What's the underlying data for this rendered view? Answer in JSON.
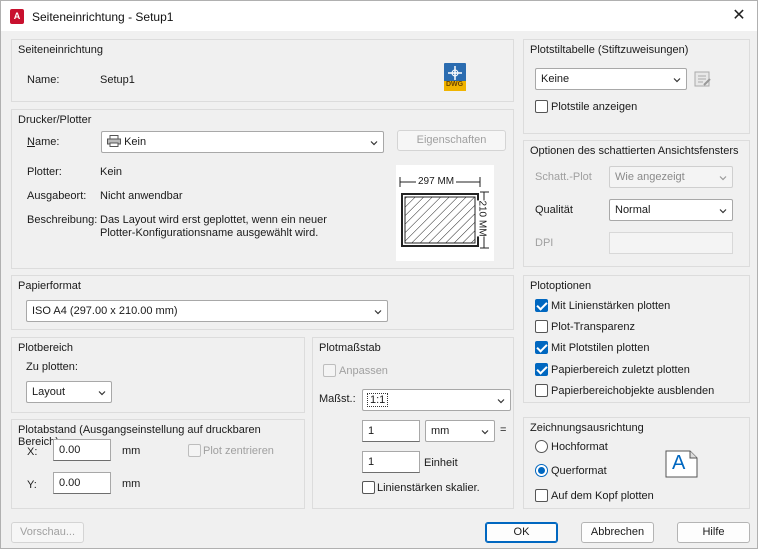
{
  "window": {
    "title": "Seiteneinrichtung - Setup1",
    "app_icon_letter": "A"
  },
  "page_setup": {
    "title": "Seiteneinrichtung",
    "name_label": "Name:",
    "name_value": "Setup1",
    "dwg_icon_text": "DWG"
  },
  "printer": {
    "title": "Drucker/Plotter",
    "name_label": "Name:",
    "name_value": "Kein",
    "properties_button": "Eigenschaften",
    "plotter_label": "Plotter:",
    "plotter_value": "Kein",
    "location_label": "Ausgabeort:",
    "location_value": "Nicht anwendbar",
    "description_label": "Beschreibung:",
    "description_line1": "Das Layout wird erst geplottet, wenn ein neuer",
    "description_line2": "Plotter-Konfigurationsname ausgewählt wird.",
    "preview_width": "297 MM",
    "preview_height": "210 MM"
  },
  "paper": {
    "title": "Papierformat",
    "value": "ISO A4 (297.00 x 210.00 mm)"
  },
  "plot_area": {
    "title": "Plotbereich",
    "what_label": "Zu plotten:",
    "what_value": "Layout"
  },
  "plot_offset": {
    "title": "Plotabstand (Ausgangseinstellung auf druckbaren Bereich)",
    "x_label": "X:",
    "x_value": "0.00",
    "x_unit": "mm",
    "y_label": "Y:",
    "y_value": "0.00",
    "y_unit": "mm",
    "center_label": "Plot zentrieren"
  },
  "plot_scale": {
    "title": "Plotmaßstab",
    "fit_label": "Anpassen",
    "scale_label": "Maßst.:",
    "scale_value": "1:1",
    "numerator": "1",
    "unit_value": "mm",
    "equals": "=",
    "denominator": "1",
    "unit_label": "Einheit",
    "scale_lineweights_label": "Linienstärken skalier."
  },
  "plot_style_table": {
    "title": "Plotstiltabelle (Stiftzuweisungen)",
    "value": "Keine",
    "show_label": "Plotstile anzeigen"
  },
  "shaded_viewport": {
    "title": "Optionen des schattierten Ansichtsfensters",
    "shade_label": "Schatt.-Plot",
    "shade_value": "Wie angezeigt",
    "quality_label": "Qualität",
    "quality_value": "Normal",
    "dpi_label": "DPI"
  },
  "plot_options": {
    "title": "Plotoptionen",
    "items": [
      {
        "label": "Mit Linienstärken plotten",
        "checked": true
      },
      {
        "label": "Plot-Transparenz",
        "checked": false
      },
      {
        "label": "Mit Plotstilen plotten",
        "checked": true
      },
      {
        "label": "Papierbereich zuletzt plotten",
        "checked": true
      },
      {
        "label": "Papierbereichobjekte ausblenden",
        "checked": false
      }
    ]
  },
  "orientation": {
    "title": "Zeichnungsausrichtung",
    "portrait_label": "Hochformat",
    "landscape_label": "Querformat",
    "upside_down_label": "Auf dem Kopf plotten",
    "icon_letter": "A"
  },
  "footer": {
    "preview_button": "Vorschau...",
    "ok_button": "OK",
    "cancel_button": "Abbrechen",
    "help_button": "Hilfe"
  },
  "colors": {
    "accent": "#0067c0",
    "app_icon": "#c8102e",
    "dialog_bg": "#f0f0f0"
  }
}
